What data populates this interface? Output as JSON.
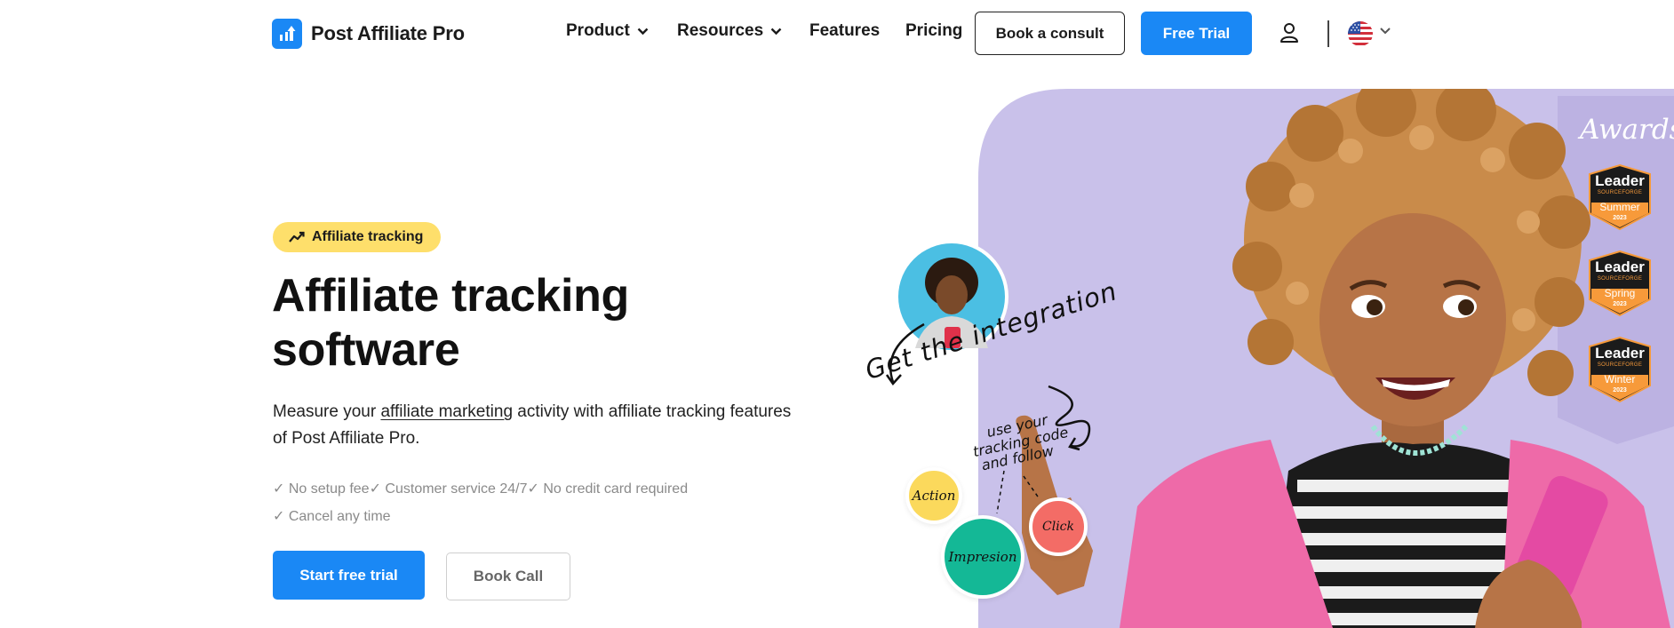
{
  "header": {
    "logo_text": "Post Affiliate Pro",
    "nav": [
      {
        "label": "Product",
        "has_dropdown": true
      },
      {
        "label": "Resources",
        "has_dropdown": true
      },
      {
        "label": "Features",
        "has_dropdown": false
      },
      {
        "label": "Pricing",
        "has_dropdown": false
      }
    ],
    "consult_label": "Book a consult",
    "trial_label": "Free Trial",
    "icons": {
      "user": "user-icon",
      "language": "us-flag-icon",
      "language_dropdown": "chevron-down-icon"
    }
  },
  "hero": {
    "badge_label": "Affiliate tracking",
    "badge_icon": "trending-up-icon",
    "title": "Affiliate tracking software",
    "desc_prefix": "Measure your ",
    "desc_link": "affiliate marketing",
    "desc_suffix": " activity with affiliate tracking features of Post Affiliate Pro.",
    "checks_line1": "✓ No setup fee✓ Customer service 24/7✓ No credit card required",
    "checks_line2": "✓ Cancel any time",
    "start_label": "Start free trial",
    "call_label": "Book Call"
  },
  "illustration": {
    "handwriting_main": "Get the integration",
    "handwriting_sub1": "use your",
    "handwriting_sub2": "tracking code",
    "handwriting_sub3": "and follow",
    "bubble_action": "Action",
    "bubble_impression": "Impresion",
    "bubble_click": "Click"
  },
  "awards": {
    "title": "Awards",
    "items": [
      {
        "title": "Leader",
        "brand": "SOURCEFORGE",
        "season": "Summer",
        "year": "2023"
      },
      {
        "title": "Leader",
        "brand": "SOURCEFORGE",
        "season": "Spring",
        "year": "2023"
      },
      {
        "title": "Leader",
        "brand": "SOURCEFORGE",
        "season": "Winter",
        "year": "2023"
      }
    ]
  },
  "colors": {
    "brand_blue": "#1a88f5",
    "badge_yellow": "#fedf6b",
    "panel_lavender": "#c9c1ea",
    "bubble_yellow": "#fbd95c",
    "bubble_teal": "#14b896",
    "bubble_coral": "#f36c66"
  }
}
